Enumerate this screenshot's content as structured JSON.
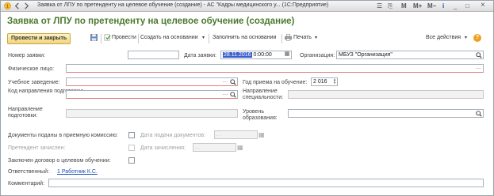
{
  "window": {
    "title": "Заявка от ЛПУ по претенденту на целевое обучение (создание) - АС \"Кадры медицинского у... (1С:Предприятие)",
    "controls": [
      "☰",
      "⎘",
      "M",
      "M+",
      "M−",
      "i",
      "_",
      "□",
      "×"
    ]
  },
  "form": {
    "title": "Заявка от ЛПУ по претенденту на целевое обучение (создание)"
  },
  "toolbar": {
    "post_close": "Провести и закрыть",
    "post": "Провести",
    "create_based": "Создать на основании",
    "fill_based": "Заполнить на основании",
    "print": "Печать",
    "all_actions": "Все действия",
    "help": "?"
  },
  "fields": {
    "number_label": "Номер заявки:",
    "number_value": "",
    "date_label": "Дата заявки:",
    "date_value": "28.11.2016",
    "date_time": "0:00:00",
    "org_label": "Организация:",
    "org_value": "МБУЗ \"Организация\"",
    "person_label": "Физическое лицо:",
    "school_label": "Учебное заведение:",
    "year_label": "Год приема на обучение:",
    "year_value": "2 016",
    "code_label": "Код направления подготовки:",
    "spec_dir_label": "Направление специальности:",
    "prep_dir_label": "Направление подготовки:",
    "edu_level_label": "Уровень образования:",
    "docs_label": "Документы поданы в приемную комиссию:",
    "docs_date_label": "Дата подачи документов:",
    "docs_date_value": ". .",
    "enrolled_label": "Претендент зачислен:",
    "enrolled_date_label": "Дата зачисления:",
    "enrolled_date_value": ". .",
    "contract_label": "Заключен договор о целевом обучении:",
    "responsible_label": "Ответственный:",
    "responsible_value": "1 Работник К.С.",
    "comment_label": "Комментарий:"
  }
}
